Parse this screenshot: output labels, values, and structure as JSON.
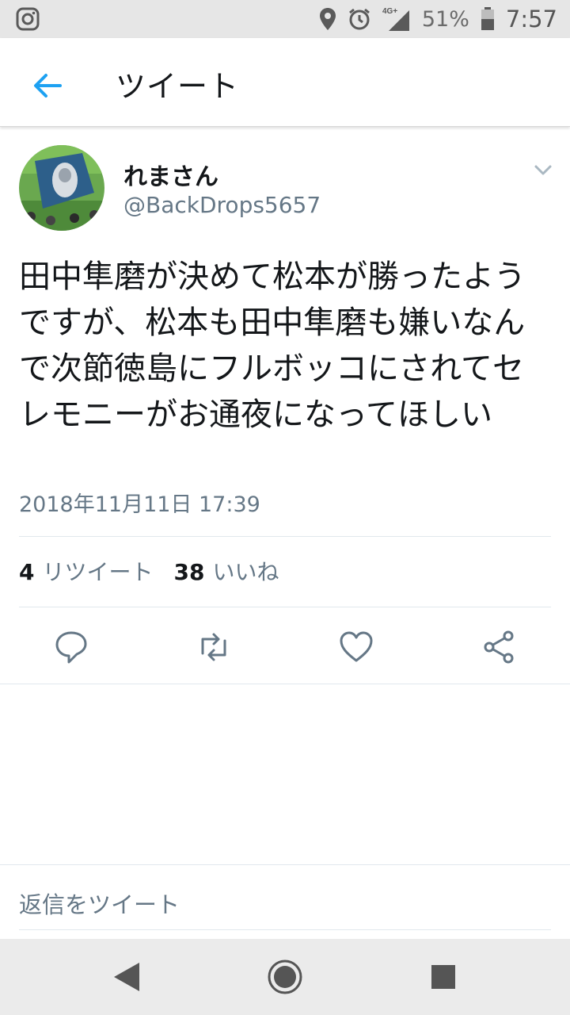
{
  "status_bar": {
    "icons": [
      "instagram-icon",
      "location-icon",
      "alarm-icon",
      "signal-4g-icon",
      "battery-icon"
    ],
    "network_label": "4G+",
    "battery": "51%",
    "time": "7:57"
  },
  "app_bar": {
    "title": "ツイート",
    "back_icon": "back-arrow-icon",
    "accent_color": "#1da1f2"
  },
  "tweet": {
    "author_name": "れまさん",
    "author_handle": "@BackDrops5657",
    "text": "田中隼磨が決めて松本が勝ったようですが、松本も田中隼磨も嫌いなんで次節徳島にフルボッコにされてセレモニーがお通夜になってほしい",
    "timestamp": "2018年11月11日 17:39",
    "retweet_count": "4",
    "retweet_label": "リツイート",
    "like_count": "38",
    "like_label": "いいね"
  },
  "actions": [
    "reply-icon",
    "retweet-icon",
    "like-icon",
    "share-icon"
  ],
  "reply_composer": {
    "placeholder": "返信をツイート"
  },
  "nav_bar": [
    "back-triangle-icon",
    "home-circle-icon",
    "recents-square-icon"
  ]
}
